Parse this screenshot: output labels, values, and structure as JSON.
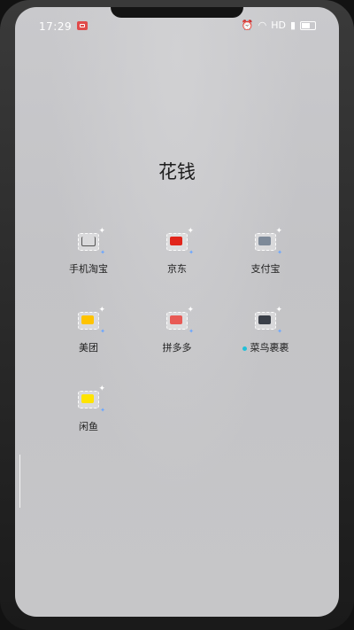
{
  "status_bar": {
    "time": "17:29",
    "network": "HD",
    "icons": [
      "recording-icon",
      "alarm-icon",
      "wifi-icon",
      "signal-icon",
      "battery-icon"
    ]
  },
  "folder": {
    "title": "花钱",
    "apps": [
      {
        "name": "手机淘宝",
        "icon": "shopping-cart-icon",
        "color": "#ff6a00"
      },
      {
        "name": "京东",
        "icon": "jd-icon",
        "color": "#e1251b"
      },
      {
        "name": "支付宝",
        "icon": "alipay-icon",
        "color": "#1677ff"
      },
      {
        "name": "美团",
        "icon": "meituan-icon",
        "color": "#ffc300"
      },
      {
        "name": "拼多多",
        "icon": "pinduoduo-icon",
        "color": "#e02e24"
      },
      {
        "name": "菜鸟裹裹",
        "icon": "cainiao-icon",
        "color": "#1a7ad9",
        "new_dot": true
      },
      {
        "name": "闲鱼",
        "icon": "xianyu-icon",
        "color": "#ffe400"
      }
    ]
  }
}
